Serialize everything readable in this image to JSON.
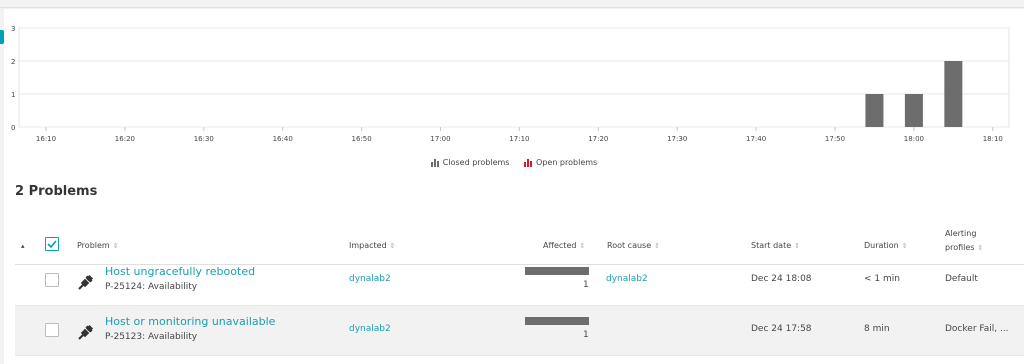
{
  "chart_data": {
    "type": "bar",
    "x_ticks": [
      "16:10",
      "16:20",
      "16:30",
      "16:40",
      "16:50",
      "17:00",
      "17:10",
      "17:20",
      "17:30",
      "17:40",
      "17:50",
      "18:00",
      "18:10"
    ],
    "y_ticks": [
      "0",
      "1",
      "2",
      "3"
    ],
    "ylim": [
      0,
      3
    ],
    "series": [
      {
        "name": "Closed problems",
        "color": "#6d6d6d",
        "points": [
          {
            "x": "17:55",
            "value": 1
          },
          {
            "x": "18:00",
            "value": 1
          },
          {
            "x": "18:05",
            "value": 2
          }
        ]
      },
      {
        "name": "Open problems",
        "color": "#dc172a",
        "points": []
      }
    ],
    "legend": [
      "Closed problems",
      "Open problems"
    ],
    "grid": true
  },
  "heading": "2 Problems",
  "columns": {
    "problem": "Problem",
    "impacted": "Impacted",
    "affected": "Affected",
    "root_cause": "Root cause",
    "start_date": "Start date",
    "duration": "Duration",
    "alerting_line1": "Alerting",
    "alerting_line2": "profiles",
    "sort_glyph": "⇕",
    "collapse_glyph": "▴"
  },
  "rows": [
    {
      "title": "Host ungracefully rebooted",
      "id": "P-25124: Availability",
      "impacted": "dynalab2",
      "affected": 1,
      "affected_label": "1",
      "root_cause": "dynalab2",
      "start": "Dec 24 18:08",
      "duration": "< 1 min",
      "alerting": "Default"
    },
    {
      "title": "Host or monitoring unavailable",
      "id": "P-25123: Availability",
      "impacted": "dynalab2",
      "affected": 1,
      "affected_label": "1",
      "root_cause": "",
      "start": "Dec 24 17:58",
      "duration": "8 min",
      "alerting": "Docker Fail, ..."
    }
  ],
  "colors": {
    "accent": "#00a1b2",
    "link": "#1a9fb0",
    "closed": "#6d6d6d",
    "open": "#dc172a"
  }
}
